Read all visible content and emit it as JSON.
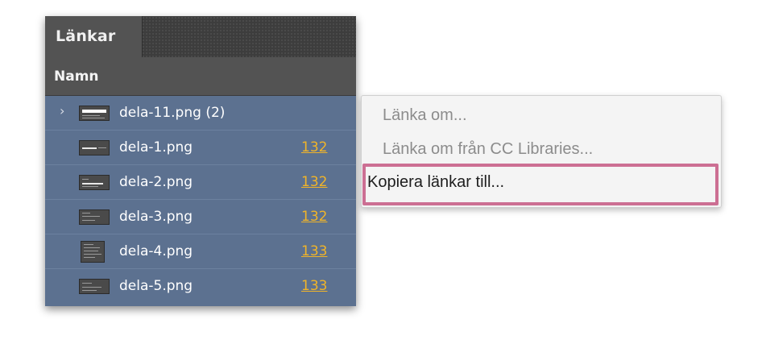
{
  "panel": {
    "tab_label": "Länkar",
    "column_header": "Namn",
    "rows": [
      {
        "name": "dela-11.png (2)",
        "page": "",
        "expandable": true
      },
      {
        "name": "dela-1.png",
        "page": "132",
        "expandable": false
      },
      {
        "name": "dela-2.png",
        "page": "132",
        "expandable": false
      },
      {
        "name": "dela-3.png",
        "page": "132",
        "expandable": false
      },
      {
        "name": "dela-4.png",
        "page": "133",
        "expandable": false
      },
      {
        "name": "dela-5.png",
        "page": "133",
        "expandable": false
      }
    ],
    "chevron_glyph": "›"
  },
  "menu": {
    "items": [
      {
        "label": "Länka om...",
        "enabled": false
      },
      {
        "label": "Länka om från CC Libraries...",
        "enabled": false
      },
      {
        "label": "Kopiera länkar till...",
        "enabled": true
      }
    ]
  },
  "colors": {
    "selection": "#5c7190",
    "page_link": "#f0b429",
    "highlight_border": "#cc6f93"
  }
}
